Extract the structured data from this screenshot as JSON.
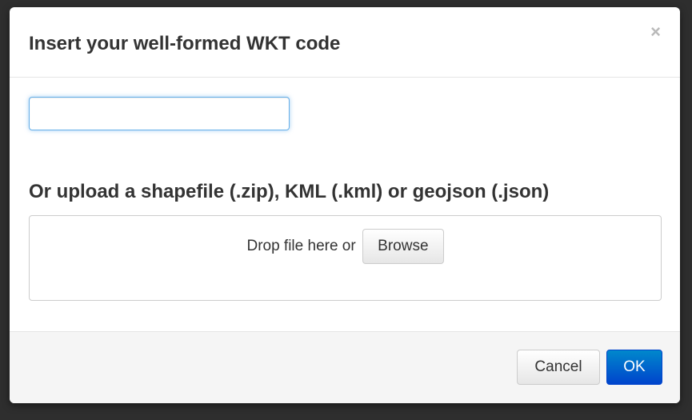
{
  "dialog": {
    "title": "Insert your well-formed WKT code",
    "close_symbol": "×",
    "wkt_input": {
      "value": "",
      "placeholder": ""
    },
    "upload_title": "Or upload a shapefile (.zip), KML (.kml) or geojson (.json)",
    "dropzone": {
      "text": "Drop file here or",
      "browse_label": "Browse"
    },
    "footer": {
      "cancel_label": "Cancel",
      "ok_label": "OK"
    }
  },
  "colors": {
    "primary": "#0055cc",
    "focus": "#66afe9"
  },
  "icons": {
    "close": "close-icon"
  }
}
